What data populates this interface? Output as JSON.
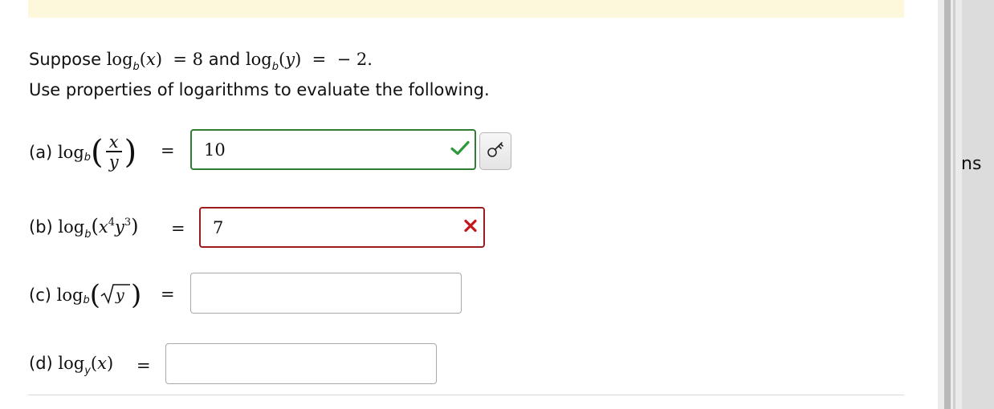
{
  "intro": {
    "suppose_word": "Suppose",
    "and_word": "and",
    "value_x": "8",
    "value_y": "− 2.",
    "instruction": "Use properties of logarithms to evaluate the following."
  },
  "parts": [
    {
      "label": "(a)",
      "answer": "10",
      "status": "correct"
    },
    {
      "label": "(b)",
      "answer": "7",
      "status": "incorrect"
    },
    {
      "label": "(c)",
      "answer": "",
      "status": "empty"
    },
    {
      "label": "(d)",
      "answer": "",
      "status": "empty"
    }
  ],
  "side_text": "ns",
  "colors": {
    "banner": "#fdf7dc",
    "correct": "#2e7d32",
    "incorrect": "#9b1c1c"
  },
  "icons": [
    "check-icon",
    "cross-icon",
    "key-icon"
  ]
}
